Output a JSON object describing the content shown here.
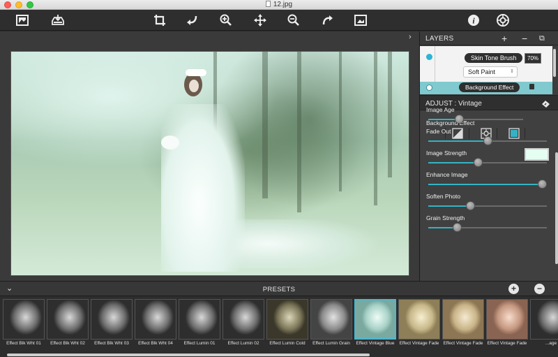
{
  "window": {
    "title": "12.jpg"
  },
  "toolbar": {
    "icons": [
      "image-open-icon",
      "save-tray-icon",
      "crop-icon",
      "undo-icon",
      "zoom-in-icon",
      "move-icon",
      "zoom-out-icon",
      "redo-icon",
      "export-image-icon",
      "info-icon",
      "settings-icon"
    ]
  },
  "layers": {
    "title": "LAYERS",
    "add_label": "+",
    "remove_label": "−",
    "items": [
      {
        "name": "Skin Tone Brush",
        "opacity": "70%",
        "blend": "Soft Paint",
        "dot_color": "#2bb5d6"
      },
      {
        "name": "Background Effect",
        "dot_color": "#ffffff"
      }
    ]
  },
  "adjust": {
    "title": "ADJUST : Vintage",
    "background_effect_label": "Background Effect",
    "sliders": [
      {
        "label": "Image Age",
        "value": 0.32
      },
      {
        "label": "Fade Out",
        "value": 0.5
      },
      {
        "label": "Image Strength",
        "value": 0.42
      },
      {
        "label": "Enhance Image",
        "value": 0.96
      },
      {
        "label": "Soften Photo",
        "value": 0.35
      },
      {
        "label": "Grain Strength",
        "value": 0.24
      }
    ],
    "swatch_color": "#e4fff2",
    "accent": "#34b3c4"
  },
  "presets": {
    "title": "PRESETS",
    "items": [
      {
        "label": "Effect Blk Wht 01",
        "tone": "bw"
      },
      {
        "label": "Effect Blk Wht 02",
        "tone": "bw"
      },
      {
        "label": "Effect Blk Wht 03",
        "tone": "bw"
      },
      {
        "label": "Effect Blk Wht 04",
        "tone": "bw"
      },
      {
        "label": "Effect Lumin 01",
        "tone": "bw"
      },
      {
        "label": "Effect Lumin 02",
        "tone": "bw"
      },
      {
        "label": "Effect Lumin Cold",
        "tone": "cold"
      },
      {
        "label": "Effect Lumin Grain",
        "tone": "grain"
      },
      {
        "label": "Effect Vintage Blue",
        "tone": "blue",
        "selected": true
      },
      {
        "label": "Effect Vintage Fade",
        "tone": "fade"
      },
      {
        "label": "Effect Vintage Fade",
        "tone": "fade2"
      },
      {
        "label": "Effect Vintage Fade",
        "tone": "warm"
      },
      {
        "label": "...age",
        "tone": "bw"
      }
    ]
  }
}
